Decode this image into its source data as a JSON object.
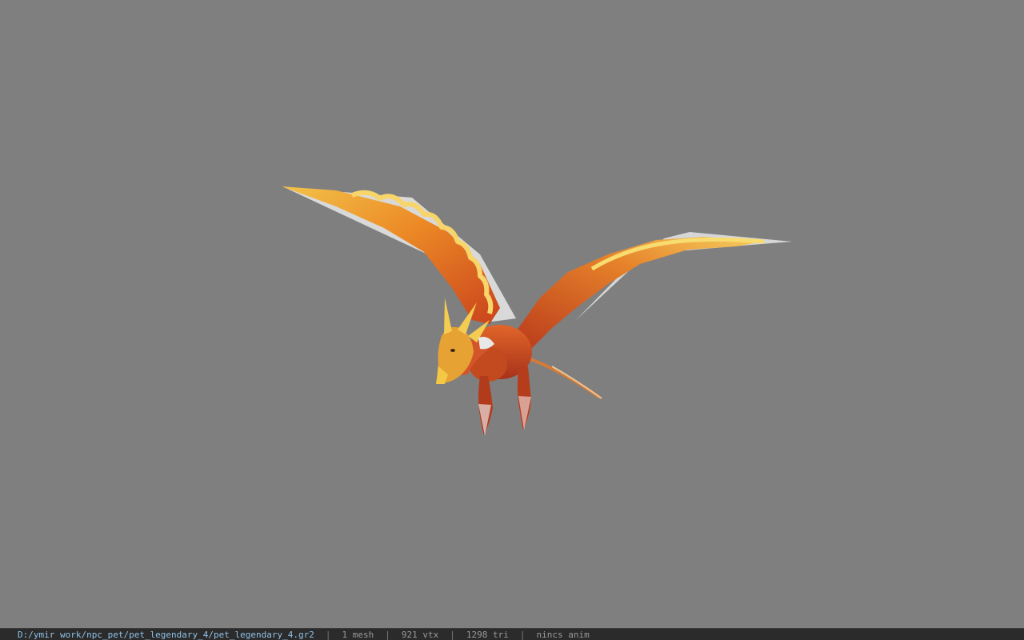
{
  "status_bar": {
    "file_path": "D:/ymir work/npc_pet/pet_legendary_4/pet_legendary_4.gr2",
    "separator": "|",
    "mesh_count": "1 mesh",
    "vertex_count": "921 vtx",
    "triangle_count": "1298 tri",
    "anim_status": "nincs anim"
  },
  "viewport": {
    "background_color": "#7f7f7f",
    "model": "phoenix-model"
  },
  "colors": {
    "status_bar_bg": "#2b2b2b",
    "path_text": "#8fc1e6",
    "stat_text": "#9a9a9a"
  }
}
